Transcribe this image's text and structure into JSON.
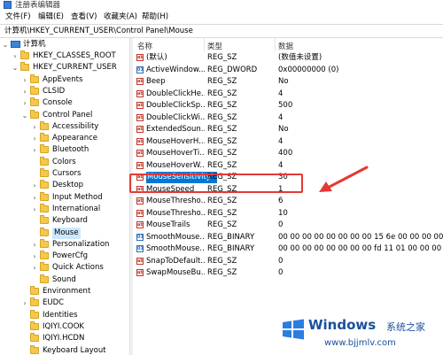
{
  "window": {
    "title": "注册表编辑器"
  },
  "menu": [
    "文件(F)",
    "编辑(E)",
    "查看(V)",
    "收藏夹(A)",
    "帮助(H)"
  ],
  "address": "计算机\\HKEY_CURRENT_USER\\Control Panel\\Mouse",
  "tree": {
    "root": "计算机",
    "items": [
      {
        "label": "HKEY_CLASSES_ROOT"
      },
      {
        "label": "HKEY_CURRENT_USER"
      },
      {
        "label": "AppEvents"
      },
      {
        "label": "CLSID"
      },
      {
        "label": "Console"
      },
      {
        "label": "Control Panel"
      },
      {
        "label": "Accessibility"
      },
      {
        "label": "Appearance"
      },
      {
        "label": "Bluetooth"
      },
      {
        "label": "Colors"
      },
      {
        "label": "Cursors"
      },
      {
        "label": "Desktop"
      },
      {
        "label": "Input Method"
      },
      {
        "label": "International"
      },
      {
        "label": "Keyboard"
      },
      {
        "label": "Mouse"
      },
      {
        "label": "Personalization"
      },
      {
        "label": "PowerCfg"
      },
      {
        "label": "Quick Actions"
      },
      {
        "label": "Sound"
      },
      {
        "label": "Environment"
      },
      {
        "label": "EUDC"
      },
      {
        "label": "Identities"
      },
      {
        "label": "IQIYI.COOK"
      },
      {
        "label": "IQIYI.HCDN"
      },
      {
        "label": "Keyboard Layout"
      }
    ]
  },
  "list": {
    "headers": {
      "name": "名称",
      "type": "类型",
      "data": "数据"
    },
    "rows": [
      {
        "icon": "string-value-icon",
        "name": "(默认)",
        "type": "REG_SZ",
        "data": "(数值未设置)"
      },
      {
        "icon": "binary-value-icon",
        "name": "ActiveWindow...",
        "type": "REG_DWORD",
        "data": "0x00000000 (0)"
      },
      {
        "icon": "string-value-icon",
        "name": "Beep",
        "type": "REG_SZ",
        "data": "No"
      },
      {
        "icon": "string-value-icon",
        "name": "DoubleClickHe...",
        "type": "REG_SZ",
        "data": "4"
      },
      {
        "icon": "string-value-icon",
        "name": "DoubleClickSp...",
        "type": "REG_SZ",
        "data": "500"
      },
      {
        "icon": "string-value-icon",
        "name": "DoubleClickWi...",
        "type": "REG_SZ",
        "data": "4"
      },
      {
        "icon": "string-value-icon",
        "name": "ExtendedSoun...",
        "type": "REG_SZ",
        "data": "No"
      },
      {
        "icon": "string-value-icon",
        "name": "MouseHoverH...",
        "type": "REG_SZ",
        "data": "4"
      },
      {
        "icon": "string-value-icon",
        "name": "MouseHoverTi...",
        "type": "REG_SZ",
        "data": "400"
      },
      {
        "icon": "string-value-icon",
        "name": "MouseHoverW...",
        "type": "REG_SZ",
        "data": "4"
      },
      {
        "icon": "string-value-icon",
        "name": "MouseSensitivity",
        "type": "REG_SZ",
        "data": "30"
      },
      {
        "icon": "string-value-icon",
        "name": "MouseSpeed",
        "type": "REG_SZ",
        "data": "1"
      },
      {
        "icon": "string-value-icon",
        "name": "MouseThresho...",
        "type": "REG_SZ",
        "data": "6"
      },
      {
        "icon": "string-value-icon",
        "name": "MouseThresho...",
        "type": "REG_SZ",
        "data": "10"
      },
      {
        "icon": "string-value-icon",
        "name": "MouseTrails",
        "type": "REG_SZ",
        "data": "0"
      },
      {
        "icon": "binary-value-icon",
        "name": "SmoothMouse...",
        "type": "REG_BINARY",
        "data": "00 00 00 00 00 00 00 00 15 6e 00 00 00 00 00 ..."
      },
      {
        "icon": "binary-value-icon",
        "name": "SmoothMouse...",
        "type": "REG_BINARY",
        "data": "00 00 00 00 00 00 00 00 fd 11 01 00 00 00 00 ..."
      },
      {
        "icon": "string-value-icon",
        "name": "SnapToDefault...",
        "type": "REG_SZ",
        "data": "0"
      },
      {
        "icon": "string-value-icon",
        "name": "SwapMouseBu...",
        "type": "REG_SZ",
        "data": "0"
      }
    ]
  },
  "watermark": {
    "title": "Windows",
    "subtitle": "系统之家",
    "url": "www.bjjmlv.com"
  },
  "colors": {
    "selection": "#0078d7",
    "highlight_box": "#e53935",
    "folder": "#f5c84b",
    "watermark": "#1a4f9c"
  }
}
